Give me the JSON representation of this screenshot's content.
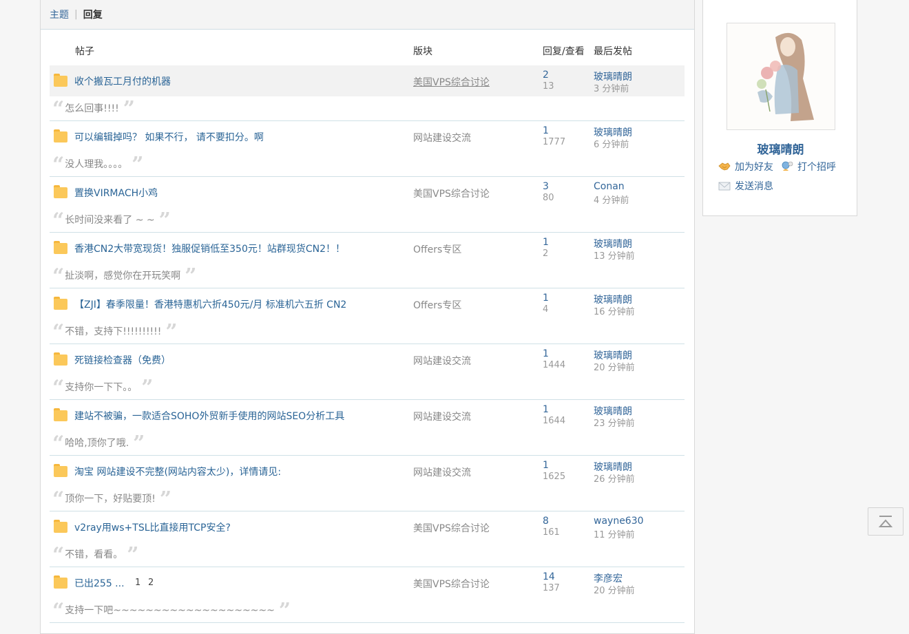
{
  "tabs": {
    "topic": "主题",
    "reply": "回复"
  },
  "table_header": {
    "post": "帖子",
    "forum": "版块",
    "replies_views": "回复/查看",
    "last_post": "最后发帖"
  },
  "rows": [
    {
      "title": "收个搬瓦工月付的机器",
      "forum": "美国VPS综合讨论",
      "replies": "2",
      "views": "13",
      "last_user": "玻璃晴朗",
      "last_time": "3 分钟前",
      "quote": "怎么回事!!!!"
    },
    {
      "title": "可以编辑掉吗？ 如果不行， 请不要扣分。啊",
      "forum": "网站建设交流",
      "replies": "1",
      "views": "1777",
      "last_user": "玻璃晴朗",
      "last_time": "6 分钟前",
      "quote": "没人理我。。。。"
    },
    {
      "title": "置换VIRMACH小鸡",
      "forum": "美国VPS综合讨论",
      "replies": "3",
      "views": "80",
      "last_user": "Conan",
      "last_time": "4 分钟前",
      "quote": "长时间没来看了 ~ ~"
    },
    {
      "title": "香港CN2大带宽现货！独服促销低至350元！站群现货CN2！！",
      "forum": "Offers专区",
      "replies": "1",
      "views": "2",
      "last_user": "玻璃晴朗",
      "last_time": "13 分钟前",
      "quote": "扯淡啊，感觉你在开玩笑啊"
    },
    {
      "title": "【ZJI】春季限量！香港特惠机六折450元/月 标准机六五折 CN2",
      "forum": "Offers专区",
      "replies": "1",
      "views": "4",
      "last_user": "玻璃晴朗",
      "last_time": "16 分钟前",
      "quote": "不错，支持下!!!!!!!!!!"
    },
    {
      "title": "死链接检查器（免费）",
      "forum": "网站建设交流",
      "replies": "1",
      "views": "1444",
      "last_user": "玻璃晴朗",
      "last_time": "20 分钟前",
      "quote": "支持你一下下。。"
    },
    {
      "title": "建站不被骗，一款适合SOHO外贸新手使用的网站SEO分析工具",
      "forum": "网站建设交流",
      "replies": "1",
      "views": "1644",
      "last_user": "玻璃晴朗",
      "last_time": "23 分钟前",
      "quote": "哈哈,顶你了哦."
    },
    {
      "title": "淘宝 网站建设不完整(网站内容太少)，详情请见:",
      "forum": "网站建设交流",
      "replies": "1",
      "views": "1625",
      "last_user": "玻璃晴朗",
      "last_time": "26 分钟前",
      "quote": "顶你一下，好贴要顶!"
    },
    {
      "title": "v2ray用ws+TSL比直接用TCP安全?",
      "forum": "美国VPS综合讨论",
      "replies": "8",
      "views": "161",
      "last_user": "wayne630",
      "last_time": "11 分钟前",
      "quote": "不错，看看。"
    },
    {
      "title": "已出255 ...",
      "pages": [
        "1",
        "2"
      ],
      "forum": "美国VPS综合讨论",
      "replies": "14",
      "views": "137",
      "last_user": "李彦宏",
      "last_time": "20 分钟前",
      "quote": "支持一下吧~~~~~~~~~~~~~~~~~~~~"
    }
  ],
  "sidebar": {
    "username": "玻璃晴朗",
    "add_friend": "加为好友",
    "greet": "打个招呼",
    "send_message": "发送消息"
  }
}
